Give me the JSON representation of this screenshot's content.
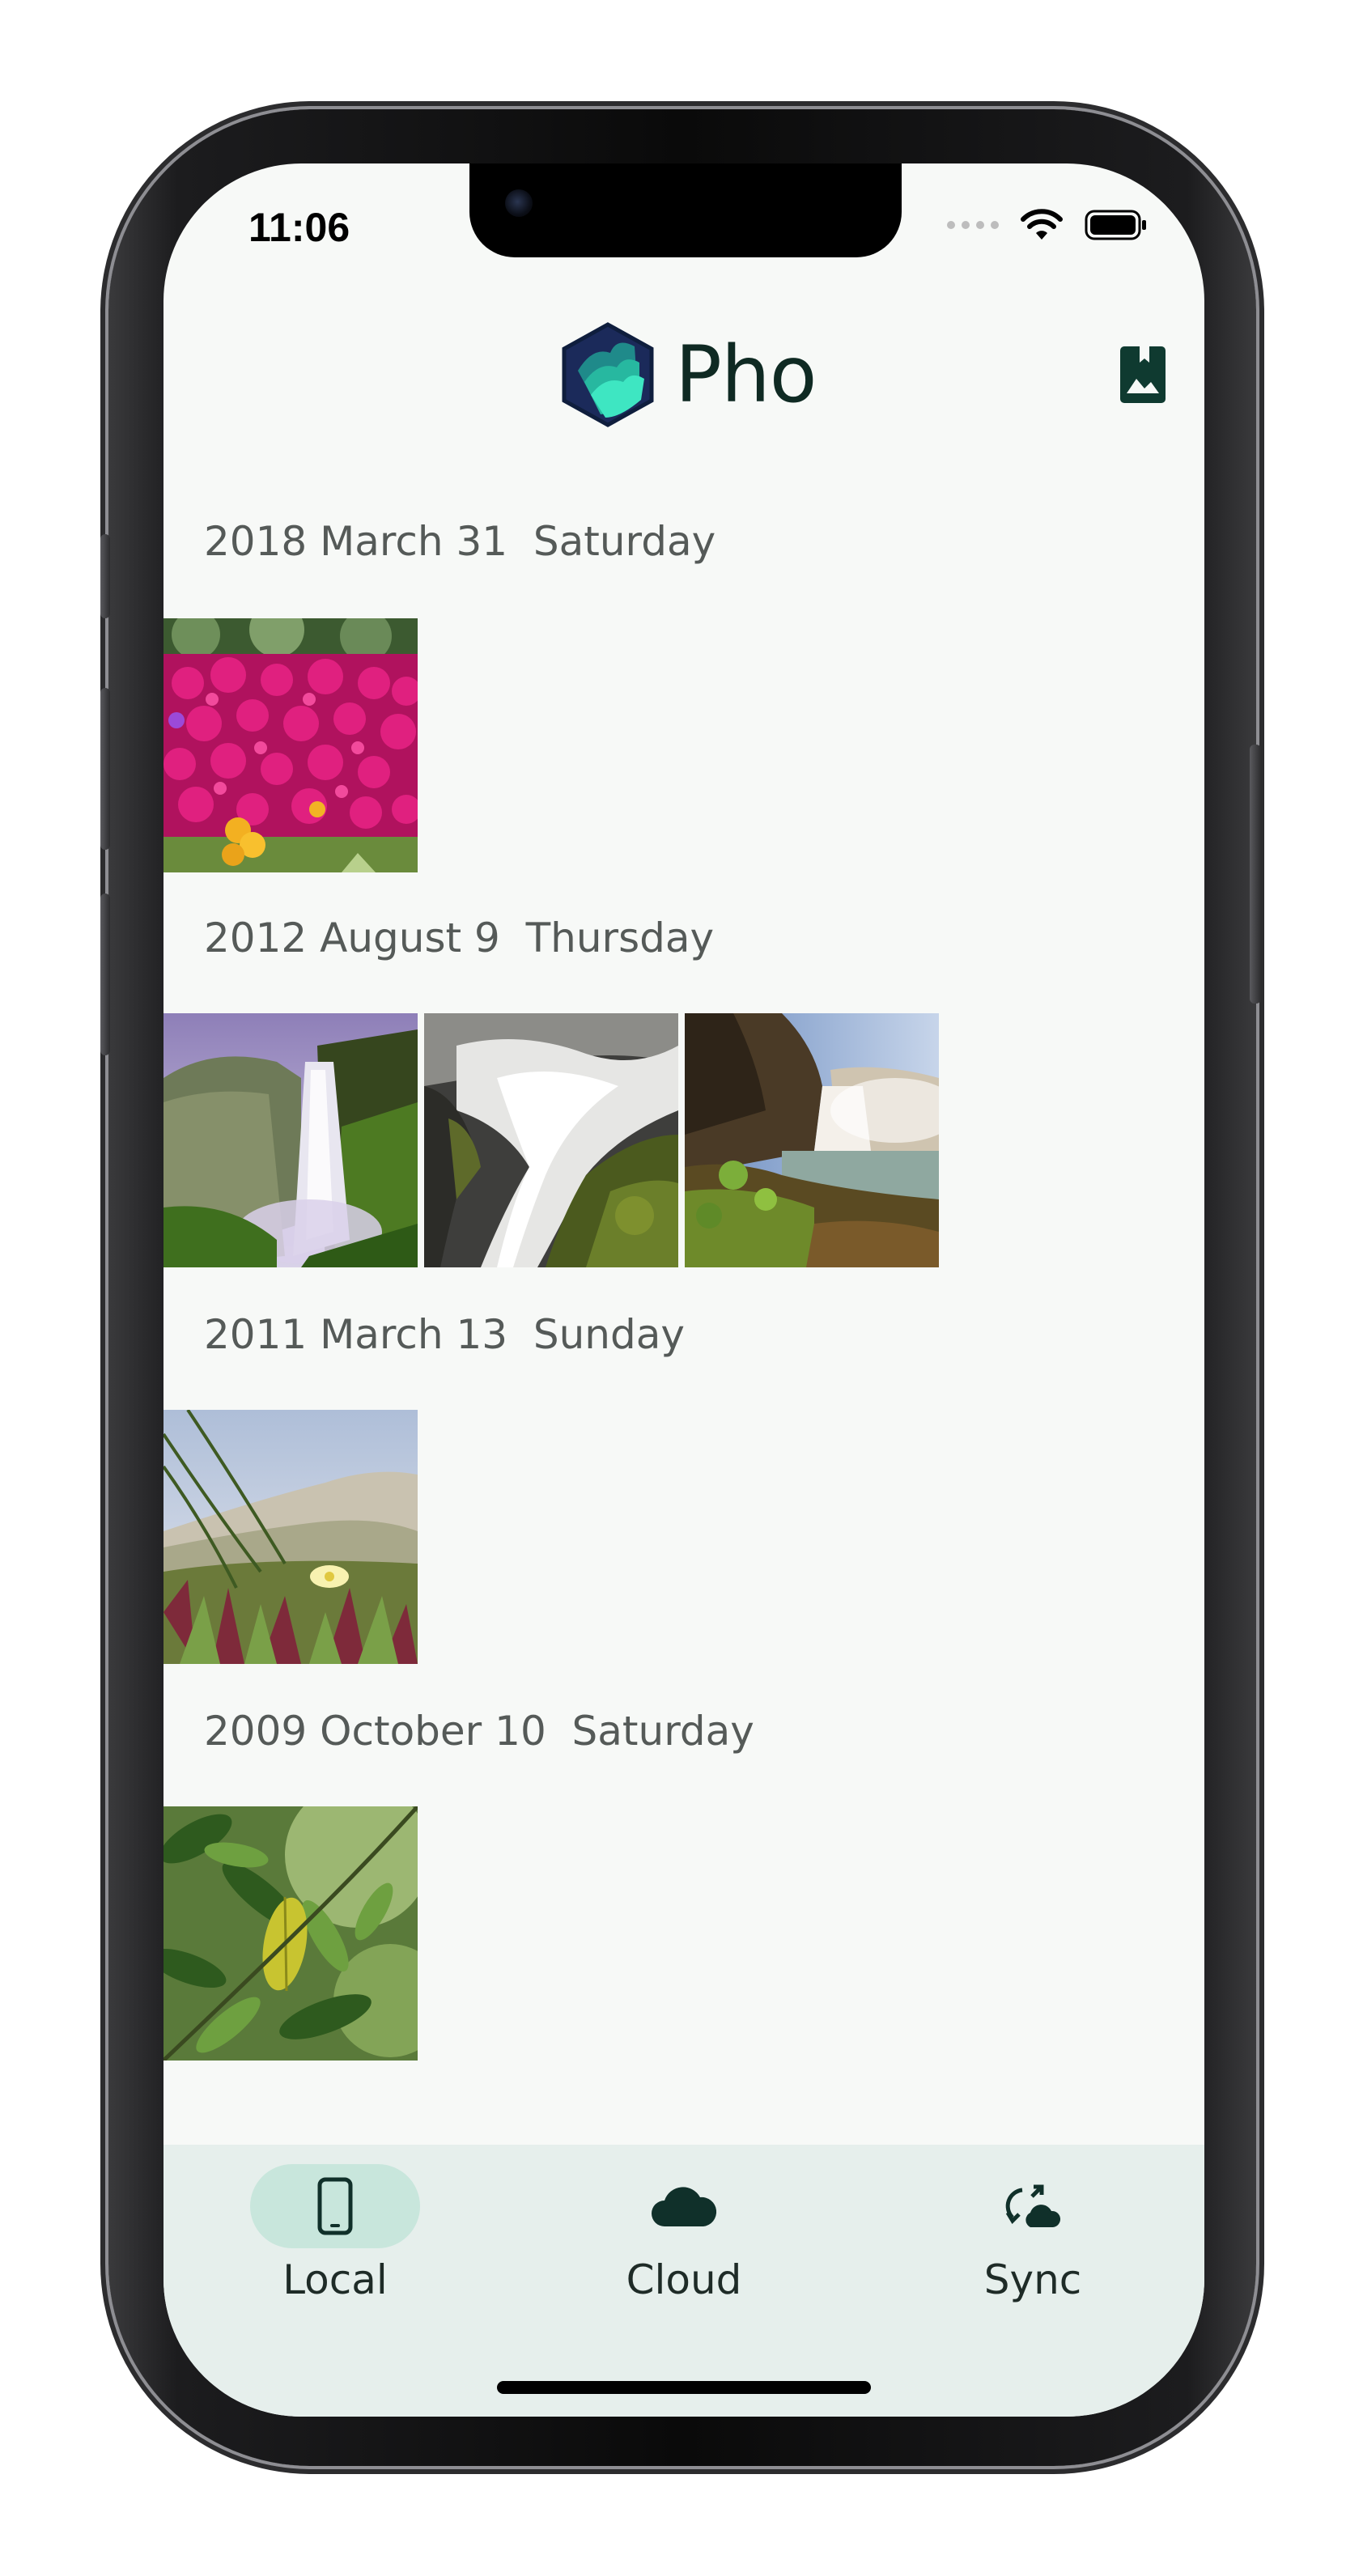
{
  "status_bar": {
    "time": "11:06"
  },
  "header": {
    "app_name": "Pho",
    "logo_icon": "hexagon-layers-logo",
    "action_icon": "photo-bookmark-icon"
  },
  "sections": [
    {
      "title": "2018 March 31  Saturday",
      "photos": [
        "magenta-flowers"
      ]
    },
    {
      "title": "2012 August 9  Thursday",
      "photos": [
        "waterfall-cliff",
        "waterfall-rocks",
        "waterfall-shore"
      ]
    },
    {
      "title": "2011 March 13  Sunday",
      "photos": [
        "dune-plants"
      ]
    },
    {
      "title": "2009 October 10  Saturday",
      "photos": [
        "green-leaves"
      ]
    }
  ],
  "bottom_nav": {
    "items": [
      {
        "label": "Local",
        "icon": "phone-icon",
        "active": true
      },
      {
        "label": "Cloud",
        "icon": "cloud-icon",
        "active": false
      },
      {
        "label": "Sync",
        "icon": "sync-cloud-icon",
        "active": false
      }
    ]
  },
  "colors": {
    "background": "#f7f9f7",
    "nav_background": "#e6efec",
    "active_pill": "#c8e6dc",
    "brand_dark": "#0f2a23",
    "brand_teal": "#2ec4a6"
  }
}
